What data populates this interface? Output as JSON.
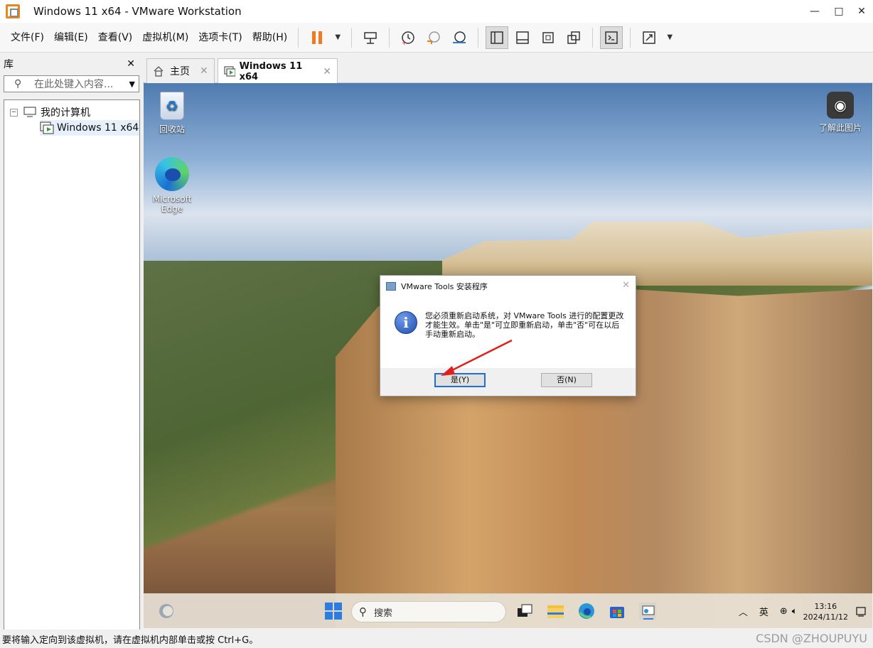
{
  "window": {
    "title": "Windows 11 x64 - VMware Workstation",
    "minimize": "—",
    "maximize": "□",
    "close": "✕"
  },
  "menu": [
    "文件(F)",
    "编辑(E)",
    "查看(V)",
    "虚拟机(M)",
    "选项卡(T)",
    "帮助(H)"
  ],
  "toolbar_icons": [
    "pause-icon",
    "dropdown-icon",
    "send-ctrl-alt-del-icon",
    "snapshot-icon",
    "revert-snapshot-icon",
    "snapshot-manager-icon",
    "library-view-icon",
    "thumbnail-view-icon",
    "fullscreen-icon",
    "unity-icon",
    "console-icon",
    "stretch-icon"
  ],
  "library": {
    "title": "库",
    "close": "✕",
    "search_placeholder": "在此处键入内容...",
    "tree": {
      "root": "我的计算机",
      "child": "Windows 11 x64"
    }
  },
  "tabs": [
    {
      "label": "主页",
      "active": false
    },
    {
      "label": "Windows 11 x64",
      "active": true
    }
  ],
  "desktop": {
    "recycle_bin": "回收站",
    "edge_line1": "Microsoft",
    "edge_line2": "Edge",
    "learn_more": "了解此图片"
  },
  "dialog": {
    "title": "VMware Tools 安装程序",
    "close": "✕",
    "message": "您必须重新启动系统，对 VMware Tools 进行的配置更改才能生效。单击\"是\"可立即重新启动，单击\"否\"可在以后手动重新启动。",
    "yes_label": "是(Y)",
    "no_label": "否(N)"
  },
  "taskbar": {
    "search_label": "搜索",
    "ime": "英",
    "time": "13:16",
    "date": "2024/11/12"
  },
  "statusbar": {
    "text": "要将输入定向到该虚拟机，请在虚拟机内部单击或按 Ctrl+G。",
    "watermark": "CSDN @ZHOUPUYU"
  },
  "colors": {
    "accent_orange": "#f07a1e",
    "dialog_button_focus": "#1f6ed6",
    "arrow_red": "#e0201e"
  }
}
